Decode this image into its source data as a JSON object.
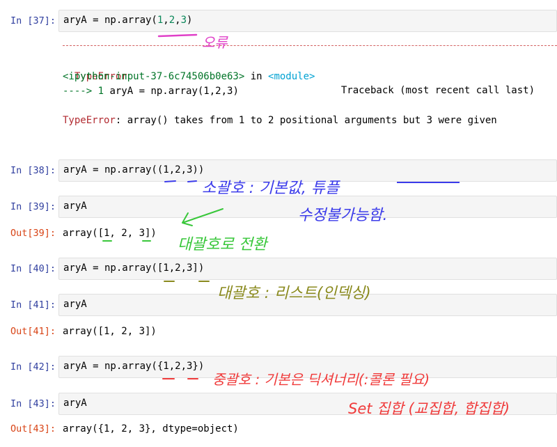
{
  "cells": [
    {
      "in_prompt": "In [37]:",
      "code_pre": "aryA = np.array(",
      "code_nums": [
        "1",
        ",",
        "2",
        ",",
        "3"
      ],
      "code_post": ")"
    },
    {
      "in_prompt": "In [38]:",
      "code": "aryA = np.array((1,2,3))"
    },
    {
      "in_prompt": "In [39]:",
      "code": "aryA",
      "out_prompt": "Out[39]:",
      "output": "array([1, 2, 3])"
    },
    {
      "in_prompt": "In [40]:",
      "code": "aryA = np.array([1,2,3])"
    },
    {
      "in_prompt": "In [41]:",
      "code": "aryA",
      "out_prompt": "Out[41]:",
      "output": "array([1, 2, 3])"
    },
    {
      "in_prompt": "In [42]:",
      "code": "aryA = np.array({1,2,3})"
    },
    {
      "in_prompt": "In [43]:",
      "code": "aryA",
      "out_prompt": "Out[43]:",
      "output": "array({1, 2, 3}, dtype=object)"
    }
  ],
  "error": {
    "type": "TypeError",
    "traceback_label": "Traceback (most recent call last)",
    "input_ref": "<ipython-input-37-6c74506b0e63>",
    "in_word": " in ",
    "module": "<module>",
    "arrow": "----> 1 ",
    "arrow_code": "aryA = np.array(1,2,3)",
    "message_type": "TypeError",
    "message": ": array() takes from 1 to 2 positional arguments but 3 were given"
  },
  "annotations": {
    "error_note": "오류",
    "tuple_note_line1": "소괄호 : 기본값, 튜플",
    "tuple_note_line2": "수정불가능함.",
    "converted_note": "대괄호로 전환",
    "list_note": "대괄호 : 리스트(인덱싱)",
    "set_note_line1": "중괄호 : 기본은 딕셔너리(:콜론 필요)",
    "set_note_line2": "Set 집합 (교집합, 합집합)",
    "colors": {
      "magenta": "#e040c8",
      "blue": "#3b3bea",
      "green": "#38c73a",
      "olive": "#8a8a1e",
      "red": "#f03a3a"
    }
  }
}
